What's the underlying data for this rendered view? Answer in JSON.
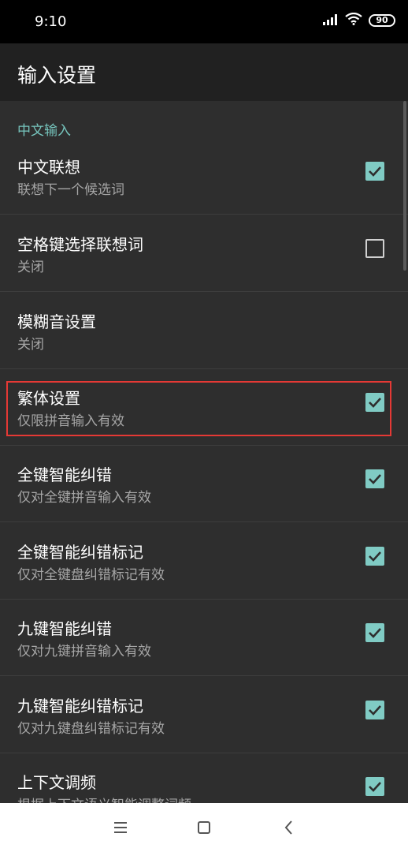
{
  "status": {
    "time": "9:10",
    "battery": "90"
  },
  "app_bar": {
    "title": "输入设置"
  },
  "section": {
    "title": "中文输入"
  },
  "prefs": [
    {
      "title": "中文联想",
      "summary": "联想下一个候选词",
      "checked": true
    },
    {
      "title": "空格键选择联想词",
      "summary": "关闭",
      "checked": false
    },
    {
      "title": "模糊音设置",
      "summary": "关闭",
      "checked": null
    },
    {
      "title": "繁体设置",
      "summary": "仅限拼音输入有效",
      "checked": true
    },
    {
      "title": "全键智能纠错",
      "summary": "仅对全键拼音输入有效",
      "checked": true
    },
    {
      "title": "全键智能纠错标记",
      "summary": "仅对全键盘纠错标记有效",
      "checked": true
    },
    {
      "title": "九键智能纠错",
      "summary": "仅对九键拼音输入有效",
      "checked": true
    },
    {
      "title": "九键智能纠错标记",
      "summary": "仅对九键盘纠错标记有效",
      "checked": true
    },
    {
      "title": "上下文调频",
      "summary": "根据上下文语义智能调整词频",
      "checked": true
    }
  ],
  "colors": {
    "accent": "#80cbc4",
    "section": "#76c5bd",
    "highlight": "#e53935"
  }
}
